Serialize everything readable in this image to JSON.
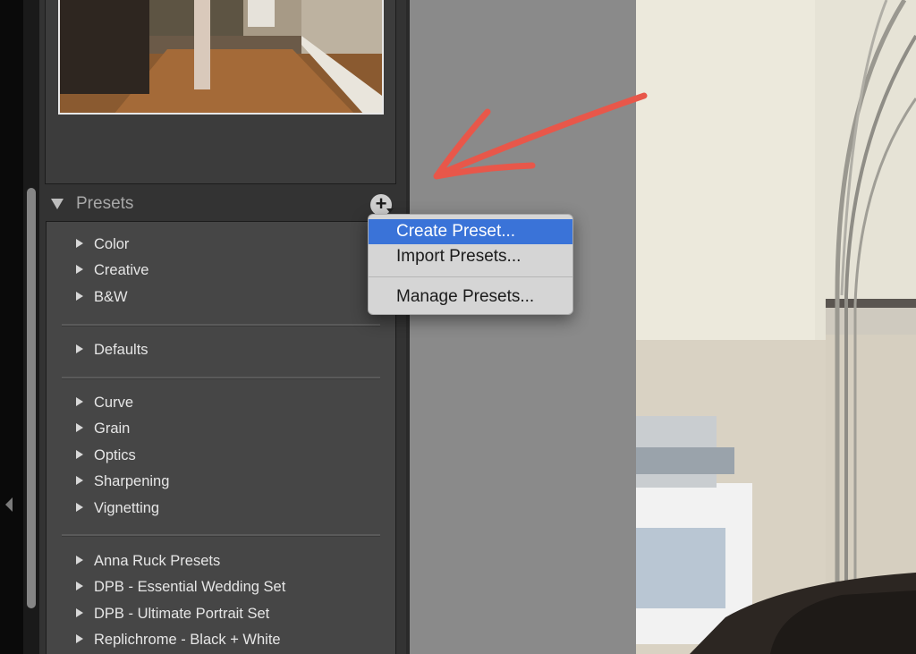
{
  "presets": {
    "title": "Presets",
    "add_glyph": "+",
    "groups": [
      [
        "Color",
        "Creative",
        "B&W"
      ],
      [
        "Defaults"
      ],
      [
        "Curve",
        "Grain",
        "Optics",
        "Sharpening",
        "Vignetting"
      ],
      [
        "Anna Ruck Presets",
        "DPB - Essential Wedding Set",
        "DPB - Ultimate Portrait Set",
        "Replichrome - Black + White"
      ]
    ]
  },
  "menu": {
    "items": [
      "Create Preset...",
      "Import Presets...",
      "Manage Presets..."
    ],
    "highlighted_index": 0
  },
  "colors": {
    "annotation_arrow": "#e8574a",
    "menu_highlight": "#3a73d8"
  }
}
